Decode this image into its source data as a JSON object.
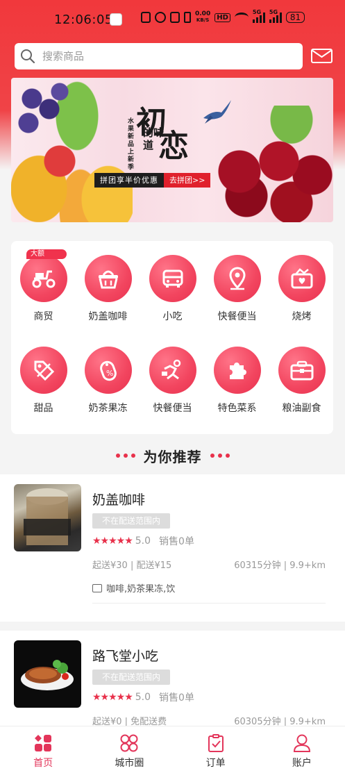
{
  "status_bar": {
    "time": "12:06:05",
    "net_speed_value": "0.00",
    "net_speed_unit": "KB/S",
    "hd": "HD",
    "signal1": "5G",
    "signal2": "5G",
    "battery": "81"
  },
  "search": {
    "placeholder": "搜索商品"
  },
  "banner": {
    "side_text": "水果新品上新季",
    "title_char_1": "初",
    "title_char_2": "恋",
    "title_small": "的味道",
    "promo_label": "拼团享半价优惠",
    "promo_button": "去拼团>>"
  },
  "categories": [
    {
      "label": "商贸",
      "badge": "大额",
      "icon": "scooter-icon"
    },
    {
      "label": "奶盖咖啡",
      "icon": "basket-icon"
    },
    {
      "label": "小吃",
      "icon": "car-icon"
    },
    {
      "label": "快餐便当",
      "icon": "location-pin-icon"
    },
    {
      "label": "烧烤",
      "icon": "gift-box-icon"
    },
    {
      "label": "甜品",
      "icon": "coupon-tag-icon"
    },
    {
      "label": "奶茶果冻",
      "icon": "discount-tag-icon"
    },
    {
      "label": "快餐便当",
      "icon": "delivery-runner-icon"
    },
    {
      "label": "特色菜系",
      "icon": "puzzle-icon"
    },
    {
      "label": "粮油副食",
      "icon": "toolbox-icon"
    }
  ],
  "recommend": {
    "title": "为你推荐"
  },
  "shops": [
    {
      "name": "奶盖咖啡",
      "tag": "不在配送范围内",
      "stars": "★★★★★",
      "rating": "5.0",
      "sales": "销售0单",
      "delivery": "起送¥30 | 配送¥15",
      "distance": "60315分钟 | 9.9+km",
      "categories": "咖啡,奶茶果冻,饮"
    },
    {
      "name": "路飞堂小吃",
      "tag": "不在配送范围内",
      "stars": "★★★★★",
      "rating": "5.0",
      "sales": "销售0单",
      "delivery": "起送¥0 | 免配送费",
      "distance": "60305分钟 | 9.9+km"
    }
  ],
  "tabs": [
    {
      "label": "首页",
      "active": true
    },
    {
      "label": "城市圈"
    },
    {
      "label": "订单"
    },
    {
      "label": "账户"
    }
  ],
  "colors": {
    "accent": "#e8314b",
    "header_red": "#f1383c",
    "tab_active": "#e3355a"
  }
}
